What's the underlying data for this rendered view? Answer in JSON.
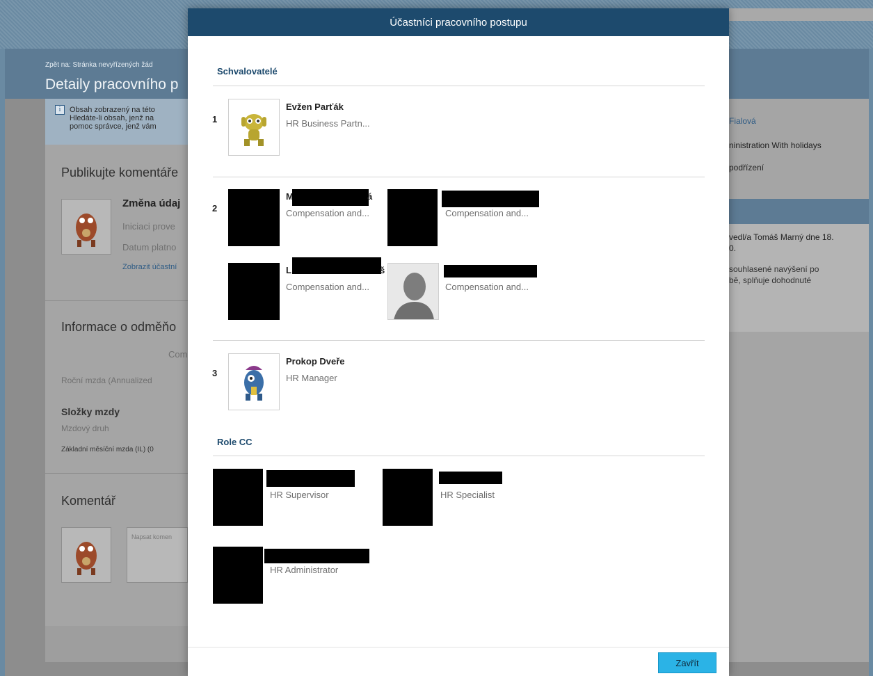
{
  "background": {
    "breadcrumb": "Zpět na: Stránka nevyřízených žád",
    "page_title": "Detaily pracovního p",
    "info_text": [
      "Obsah zobrazený na této",
      "Hledáte-li obsah, jenž na",
      "pomoc správce, jenž vám"
    ],
    "section_comments_publish": "Publikujte komentáře",
    "card_title": "Změna údaj",
    "card_initiator": "Iniciaci prove",
    "card_date": "Datum platno",
    "card_link": "Zobrazit účastní",
    "section_compensation": "Informace o odměňo",
    "com_label": "Com",
    "annual_salary": "Roční mzda (Annualized",
    "wage_components": "Složky mzdy",
    "wage_type": "Mzdový druh",
    "base_salary": "Základní měsíční mzda (IL) (0",
    "section_comment": "Komentář",
    "comment_placeholder": "Napsat komen",
    "right_name": "Fialová",
    "right_admin": "ninistration With holidays",
    "right_sub": "podřízení",
    "right_note_1": "vedl/a Tomáš Marný dne 18.",
    "right_note_2": "0.",
    "right_note_3": "souhlasené navýšení po",
    "right_note_4": "bě, splňuje dohodnuté"
  },
  "dialog": {
    "title": "Účastníci pracovního postupu",
    "approvers_title": "Schvalovatelé",
    "steps": [
      {
        "number": "1",
        "participants": [
          {
            "name": "Evžen Parťák",
            "role": "HR Business Partn..."
          }
        ]
      },
      {
        "number": "2",
        "participants": [
          {
            "name_visible": "M",
            "name_tail": "á",
            "role": "Compensation and..."
          },
          {
            "name_visible": "",
            "name_tail": "",
            "role": "Compensation and..."
          },
          {
            "name_visible": "L",
            "name_tail": "š",
            "role": "Compensation and..."
          },
          {
            "name_visible": "",
            "name_tail": "",
            "role": "Compensation and..."
          }
        ]
      },
      {
        "number": "3",
        "participants": [
          {
            "name": "Prokop Dveře",
            "role": "HR Manager"
          }
        ]
      }
    ],
    "cc_title": "Role CC",
    "cc": [
      {
        "role": "HR Supervisor"
      },
      {
        "role": "HR Specialist"
      },
      {
        "role": "HR Administrator"
      }
    ],
    "close_label": "Zavřít"
  },
  "colors": {
    "header": "#1d4a6d",
    "accent": "#1d4a6d",
    "button": "#2bb3e6"
  }
}
